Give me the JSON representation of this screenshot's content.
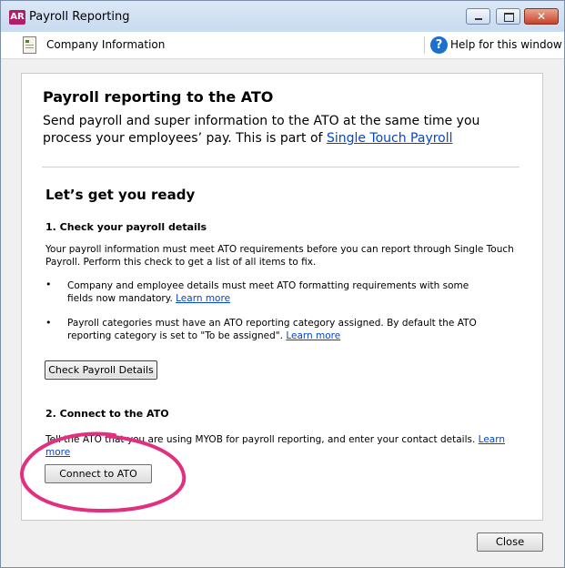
{
  "window": {
    "app_badge": "AR",
    "title": "Payroll Reporting"
  },
  "toolbar": {
    "company_info": "Company Information",
    "help": "Help for this window"
  },
  "main": {
    "heading": "Payroll reporting to the ATO",
    "intro": "Send payroll and super information to the ATO at the same time you process your employees’ pay. This is part of ",
    "intro_link": "Single Touch Payroll",
    "subheading": "Let’s get you ready",
    "step1": {
      "title": "1. Check your payroll details",
      "desc": "Your payroll information must meet ATO requirements before you can report through Single Touch Payroll. Perform this check to get a list of all items to fix.",
      "bullets": [
        {
          "text": "Company and employee details must meet ATO formatting requirements with some fields now mandatory. ",
          "link": "Learn more"
        },
        {
          "text": "Payroll categories must have an ATO reporting category assigned. By default the ATO reporting category is set to \"To be assigned\". ",
          "link": "Learn more"
        }
      ],
      "button": "Check Payroll Details"
    },
    "step2": {
      "title": "2. Connect to the ATO",
      "desc": "Tell the ATO that you are using MYOB for payroll reporting, and enter your contact details. ",
      "desc_link": "Learn more",
      "button": "Connect to ATO"
    }
  },
  "footer": {
    "close": "Close"
  },
  "colors": {
    "link": "#0645c8",
    "annotation": "#e0307f",
    "badge": "#b51a6b"
  },
  "icons": [
    "document-icon",
    "help-icon",
    "minimize-icon",
    "maximize-icon",
    "close-icon"
  ]
}
